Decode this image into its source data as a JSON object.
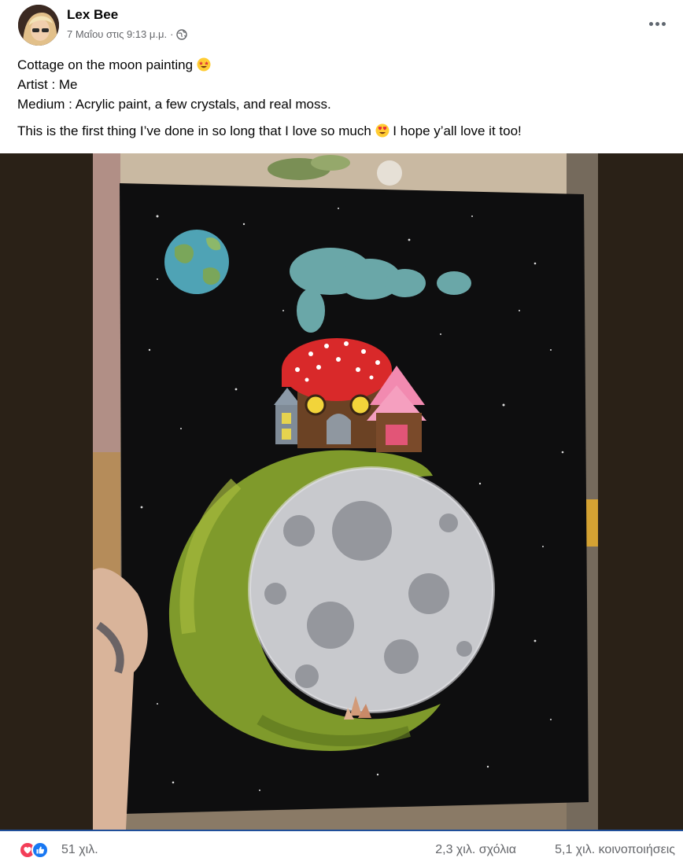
{
  "post": {
    "author": "Lex Bee",
    "timestamp": "7 Μαΐου στις 9:13 μ.μ.",
    "separator": "·",
    "privacy_icon": "globe-icon",
    "more_icon": "more-horizontal-icon",
    "text": {
      "line1": "Cottage on the moon painting",
      "line1_emoji": "star-struck-emoji",
      "line2": "Artist : Me",
      "line3": "Medium : Acrylic paint, a few crystals, and real moss.",
      "line4_a": "This is the first thing I’ve done in so long that I love so much",
      "line4_emoji": "heart-eyes-emoji",
      "line4_b": "I hope y’all love it too!"
    }
  },
  "footer": {
    "reactions_count": "51 χιλ.",
    "comments": "2,3 χιλ. σχόλια",
    "shares": "5,1 χιλ. κοινοποιήσεις",
    "reaction_icons": [
      "love-reaction-icon",
      "like-reaction-icon"
    ]
  },
  "colors": {
    "text_primary": "#050505",
    "text_secondary": "#65676b",
    "like_blue": "#1877f2",
    "love_red": "#f33e58",
    "photo_background": "#2a2117"
  }
}
